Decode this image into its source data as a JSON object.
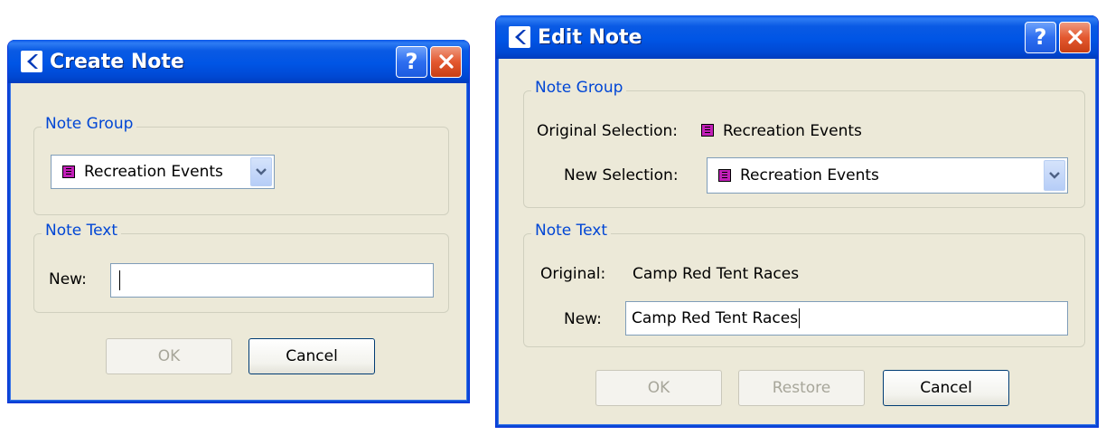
{
  "create_dialog": {
    "title": "Create Note",
    "note_group": {
      "legend": "Note Group",
      "selected": "Recreation Events"
    },
    "note_text": {
      "legend": "Note Text",
      "new_label": "New:",
      "new_value": ""
    },
    "buttons": {
      "ok": "OK",
      "cancel": "Cancel"
    }
  },
  "edit_dialog": {
    "title": "Edit Note",
    "note_group": {
      "legend": "Note Group",
      "original_label": "Original Selection:",
      "original_value": "Recreation Events",
      "new_label": "New Selection:",
      "new_value": "Recreation Events"
    },
    "note_text": {
      "legend": "Note Text",
      "original_label": "Original:",
      "original_value": "Camp Red Tent Races",
      "new_label": "New:",
      "new_value": "Camp Red Tent Races"
    },
    "buttons": {
      "ok": "OK",
      "restore": "Restore",
      "cancel": "Cancel"
    }
  },
  "titlebar": {
    "help_glyph": "?",
    "close_glyph": "✕"
  },
  "colors": {
    "title_blue": "#0055e5",
    "legend_blue": "#0046d5",
    "dialog_bg": "#ece9d8",
    "note_icon": "#c21fb8",
    "close_red": "#e3582f"
  }
}
